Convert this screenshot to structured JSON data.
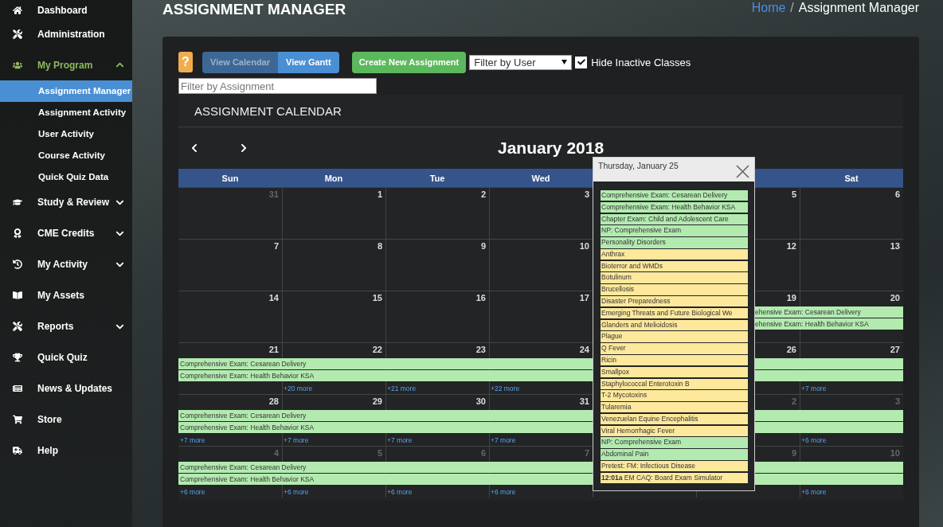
{
  "sidebar": {
    "items": [
      {
        "label": "Dashboard",
        "active": false
      },
      {
        "label": "Administration",
        "active": false
      },
      {
        "label": "My Program",
        "active": true,
        "expanded": true,
        "children": [
          {
            "label": "Assignment Manager",
            "selected": true
          },
          {
            "label": "Assignment Activity",
            "selected": false
          },
          {
            "label": "User Activity",
            "selected": false
          },
          {
            "label": "Course Activity",
            "selected": false
          },
          {
            "label": "Quick Quiz Data",
            "selected": false
          }
        ]
      },
      {
        "label": "Study & Review",
        "active": false,
        "expanded": false
      },
      {
        "label": "CME Credits",
        "active": false,
        "expanded": false
      },
      {
        "label": "My Activity",
        "active": false,
        "expanded": false
      },
      {
        "label": "My Assets",
        "active": false
      },
      {
        "label": "Reports",
        "active": false,
        "expanded": false
      },
      {
        "label": "Quick Quiz",
        "active": false
      },
      {
        "label": "News & Updates",
        "active": false
      },
      {
        "label": "Store",
        "active": false
      },
      {
        "label": "Help",
        "active": false
      }
    ]
  },
  "page_title": "ASSIGNMENT MANAGER",
  "breadcrumb": {
    "separator": "/",
    "items": [
      {
        "label": "Home",
        "kind": "link"
      },
      {
        "label": "Assignment Manager",
        "kind": "current"
      }
    ]
  },
  "toolbar": {
    "help_label": "?",
    "view_buttons": [
      {
        "label": "View Calendar",
        "selected": false
      },
      {
        "label": "View Gantt",
        "selected": true
      }
    ],
    "create_button": "Create New Assignment",
    "user_filter": {
      "value": "Filter by User"
    },
    "hide_inactive": {
      "label": "Hide Inactive Classes",
      "checked": true
    },
    "assignment_filter": {
      "placeholder": "Filter by Assignment"
    }
  },
  "calendar": {
    "title": "ASSIGNMENT CALENDAR",
    "month": "January 2018",
    "weekdays": {
      "before_popup": [
        "Sun",
        "Mon",
        "Tue",
        "Wed"
      ],
      "after_popup": [
        "Sat"
      ]
    },
    "weeks": [
      {
        "before_popup": [
          {
            "number": "31",
            "muted": true
          },
          {
            "number": "1",
            "muted": false
          },
          {
            "number": "2",
            "muted": false
          },
          {
            "number": "3",
            "muted": false
          }
        ],
        "after_popup": [
          {
            "number": "5",
            "muted": false
          },
          {
            "number": "6",
            "muted": false
          }
        ]
      },
      {
        "before_popup": [
          {
            "number": "7",
            "muted": false
          },
          {
            "number": "8",
            "muted": false
          },
          {
            "number": "9",
            "muted": false
          },
          {
            "number": "10",
            "muted": false
          }
        ],
        "after_popup": [
          {
            "number": "12",
            "muted": false
          },
          {
            "number": "13",
            "muted": false
          }
        ]
      },
      {
        "before_popup": [
          {
            "number": "14",
            "muted": false
          },
          {
            "number": "15",
            "muted": false
          },
          {
            "number": "16",
            "muted": false
          },
          {
            "number": "17",
            "muted": false
          }
        ],
        "after_popup": [
          {
            "number": "19",
            "muted": false,
            "events": [
              "ehensive Exam: Cesarean Delivery",
              "ehensive Exam: Health Behavior KSA"
            ]
          },
          {
            "number": "20",
            "muted": false
          }
        ]
      },
      {
        "before_popup": [
          {
            "number": "21",
            "muted": false,
            "events": [
              "Comprehensive Exam: Cesarean Delivery",
              "Comprehensive Exam: Health Behavior KSA"
            ]
          },
          {
            "number": "22",
            "muted": false,
            "more": "+20 more"
          },
          {
            "number": "23",
            "muted": false,
            "more": "+21 more"
          },
          {
            "number": "24",
            "muted": false,
            "more": "+22 more"
          }
        ],
        "after_popup": [
          {
            "number": "26",
            "muted": false
          },
          {
            "number": "27",
            "muted": false,
            "more": "+7 more"
          }
        ]
      },
      {
        "before_popup": [
          {
            "number": "28",
            "muted": false,
            "more": "+7 more",
            "events": [
              "Comprehensive Exam: Cesarean Delivery",
              "Comprehensive Exam: Health Behavior KSA"
            ]
          },
          {
            "number": "29",
            "muted": false,
            "more": "+7 more"
          },
          {
            "number": "30",
            "muted": false,
            "more": "+7 more"
          },
          {
            "number": "31",
            "muted": false,
            "more": "+7 more"
          }
        ],
        "after_popup": [
          {
            "number": "2",
            "muted": true
          },
          {
            "number": "3",
            "muted": true,
            "more": "+6 more"
          }
        ]
      },
      {
        "before_popup": [
          {
            "number": "4",
            "muted": true,
            "more": "+6 more",
            "events": [
              "Comprehensive Exam: Cesarean Delivery",
              "Comprehensive Exam: Health Behavior KSA"
            ]
          },
          {
            "number": "5",
            "muted": true,
            "more": "+6 more"
          },
          {
            "number": "6",
            "muted": true,
            "more": "+6 more"
          },
          {
            "number": "7",
            "muted": true,
            "more": "+6 more"
          }
        ],
        "after_popup": [
          {
            "number": "9",
            "muted": true
          },
          {
            "number": "10",
            "muted": true,
            "more": "+6 more"
          }
        ]
      }
    ],
    "popup": {
      "title": "Thursday, January 25",
      "events": [
        {
          "title": "Comprehensive Exam: Cesarean Delivery",
          "color": "#b3eab0"
        },
        {
          "title": "Comprehensive Exam: Health Behavior KSA",
          "color": "#b3eab0"
        },
        {
          "title": "Chapter Exam: Child and Adolescent Care",
          "color": "#b3eab0"
        },
        {
          "title": "NP: Comprehensive Exam",
          "color": "#b3eab0"
        },
        {
          "title": "Personality Disorders",
          "color": "#b3eab0"
        },
        {
          "title": "Anthrax",
          "color": "#fde89c"
        },
        {
          "title": "Bioterror and WMDs",
          "color": "#fde89c"
        },
        {
          "title": "Botulinum",
          "color": "#fde89c"
        },
        {
          "title": "Brucellosis",
          "color": "#fde89c"
        },
        {
          "title": "Disaster Preparedness",
          "color": "#fde89c"
        },
        {
          "title": "Emerging Threats and Future Biological We",
          "color": "#fde89c"
        },
        {
          "title": "Glanders and Melioidosis",
          "color": "#fde89c"
        },
        {
          "title": "Plague",
          "color": "#fde89c"
        },
        {
          "title": "Q Fever",
          "color": "#fde89c"
        },
        {
          "title": "Ricin",
          "color": "#fde89c"
        },
        {
          "title": "Smallpox",
          "color": "#fde89c"
        },
        {
          "title": "Staphylococcal Enterotoxin B",
          "color": "#fde89c"
        },
        {
          "title": "T-2 Mycotoxins",
          "color": "#fde89c"
        },
        {
          "title": "Tularemia",
          "color": "#fde89c"
        },
        {
          "title": "Venezuelan Equine Encephalitis",
          "color": "#fde89c"
        },
        {
          "title": "Viral Hemorrhagic Fever",
          "color": "#fde89c"
        },
        {
          "title": "NP: Comprehensive Exam",
          "color": "#b3eab0"
        },
        {
          "title": "Abdominal Pain",
          "color": "#b3eab0"
        },
        {
          "title": "Pretest: FM: Infectious Disease",
          "color": "#fde89c"
        },
        {
          "title": "**12:01a** EM CAQ: Board Exam Simulator",
          "color": "#fde89c"
        }
      ]
    }
  }
}
